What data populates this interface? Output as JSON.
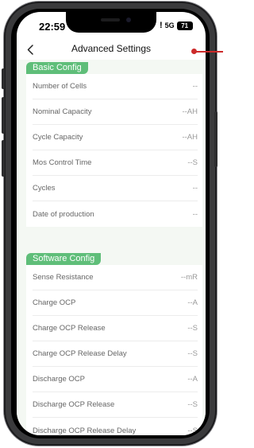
{
  "status_bar": {
    "time": "22:59",
    "alert": "!",
    "network": "5G",
    "battery": "71"
  },
  "header": {
    "title": "Advanced Settings",
    "back_icon": "chevron-left-icon"
  },
  "basic_config": {
    "label": "Basic Config",
    "rows": [
      {
        "label": "Number of Cells",
        "value": "--"
      },
      {
        "label": "Nominal Capacity",
        "value": "--AH"
      },
      {
        "label": "Cycle Capacity",
        "value": "--AH"
      },
      {
        "label": "Mos Control Time",
        "value": "--S"
      },
      {
        "label": "Cycles",
        "value": "--"
      },
      {
        "label": "Date of production",
        "value": "--"
      }
    ]
  },
  "software_config": {
    "label": "Software Config",
    "rows": [
      {
        "label": "Sense Resistance",
        "value": "--mR"
      },
      {
        "label": "Charge OCP",
        "value": "--A"
      },
      {
        "label": "Charge OCP Release",
        "value": "--S"
      },
      {
        "label": "Charge OCP Release Delay",
        "value": "--S"
      },
      {
        "label": "Discharge OCP",
        "value": "--A"
      },
      {
        "label": "Discharge OCP Release",
        "value": "--S"
      },
      {
        "label": "Discharge OCP Release Delay",
        "value": "--S"
      }
    ]
  },
  "colors": {
    "accent": "#5fbe79",
    "background": "#f4f8f3",
    "annotation": "#cc2a2a"
  }
}
